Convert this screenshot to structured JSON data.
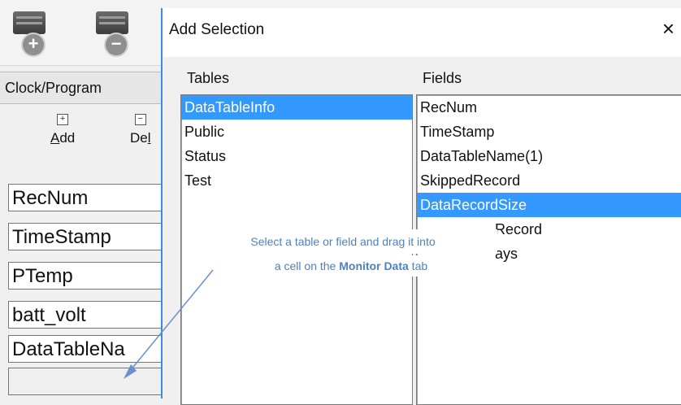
{
  "toolbar": {
    "buttons": [
      {
        "icon": "add-station-icon",
        "glyph": "+"
      },
      {
        "icon": "remove-station-icon",
        "glyph": "−"
      }
    ]
  },
  "tabs": {
    "active": "Clock/Program"
  },
  "actions": {
    "add": {
      "pre": "",
      "u": "A",
      "post": "dd"
    },
    "delete": {
      "pre": "De",
      "u": "l",
      "post": ""
    }
  },
  "cells": [
    "RecNum",
    "TimeStamp",
    "PTemp",
    "batt_volt",
    "DataTableNa",
    ""
  ],
  "dialog": {
    "title": "Add Selection",
    "close_glyph": "×",
    "tables_header": "Tables",
    "fields_header": "Fields",
    "tables": [
      "DataTableInfo",
      "Public",
      "Status",
      "Test"
    ],
    "selected_table": 0,
    "fields": [
      "RecNum",
      "TimeStamp",
      "DataTableName(1)",
      "SkippedRecord",
      "DataRecordSize",
      "SecsPerRecord",
      "Days"
    ],
    "visible_fields": [
      "RecNum",
      "TimeStamp",
      "DataTableName(1)",
      "SkippedRecord",
      "DataRecordSize",
      "Record",
      "ays"
    ],
    "selected_field": 4
  },
  "annotation": {
    "line1": "Select a table or field and drag it into",
    "line2_pre": "a cell on the ",
    "line2_bold": "Monitor Data",
    "line2_post": " tab"
  }
}
